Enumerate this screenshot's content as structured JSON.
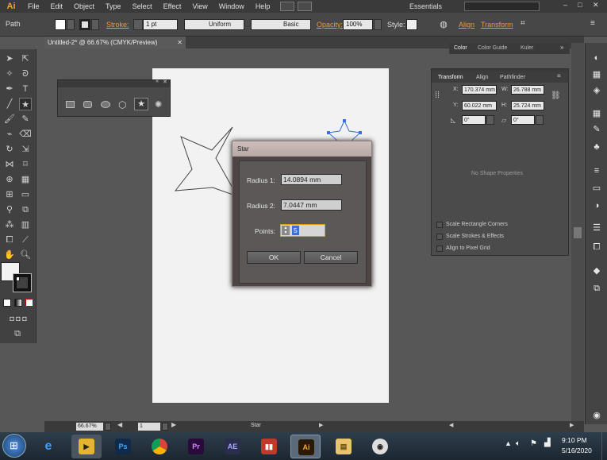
{
  "app": {
    "logo": "Ai",
    "workspace": "Essentials"
  },
  "menu": [
    "File",
    "Edit",
    "Object",
    "Type",
    "Select",
    "Effect",
    "View",
    "Window",
    "Help"
  ],
  "control_bar": {
    "selection": "Path",
    "stroke_label": "Stroke:",
    "stroke_value": "1 pt",
    "profile": "Uniform",
    "brush": "Basic",
    "opacity_label": "Opacity:",
    "opacity_value": "100%",
    "style_label": "Style:",
    "align_link": "Align",
    "transform_link": "Transform"
  },
  "document_tab": {
    "title": "Untitled-2* @ 66.67% (CMYK/Preview)"
  },
  "right_panel": {
    "top_tabs": [
      "Color",
      "Color Guide",
      "Kuler"
    ],
    "tabs": [
      "Transform",
      "Align",
      "Pathfinder"
    ],
    "x_label": "X:",
    "x_value": "170.374 mm",
    "y_label": "Y:",
    "y_value": "60.022 mm",
    "w_label": "W:",
    "w_value": "26.788 mm",
    "h_label": "H:",
    "h_value": "25.724 mm",
    "rotate_value": "0°",
    "shear_value": "0°",
    "empty_message": "No Shape Properties",
    "options": [
      "Scale Rectangle Corners",
      "Scale Strokes & Effects",
      "Align to Pixel Grid"
    ]
  },
  "dialog": {
    "title": "Star",
    "radius1_label": "Radius 1:",
    "radius1_value": "14.0894 mm",
    "radius2_label": "Radius 2:",
    "radius2_value": "7.0447 mm",
    "points_label": "Points:",
    "points_value": "5",
    "ok_label": "OK",
    "cancel_label": "Cancel"
  },
  "status_bar": {
    "zoom": "66.67%",
    "page": "1",
    "tool": "Star"
  },
  "taskbar": {
    "apps": [
      "Ps",
      "Pr",
      "AE",
      "Ai"
    ],
    "time": "9:10 PM",
    "date": "5/16/2020"
  },
  "colors": {
    "ui_dark": "#3a3a3a",
    "panel": "#4b4b4b",
    "accent_orange": "#f09a30",
    "selection_blue": "#3d6fd6"
  }
}
